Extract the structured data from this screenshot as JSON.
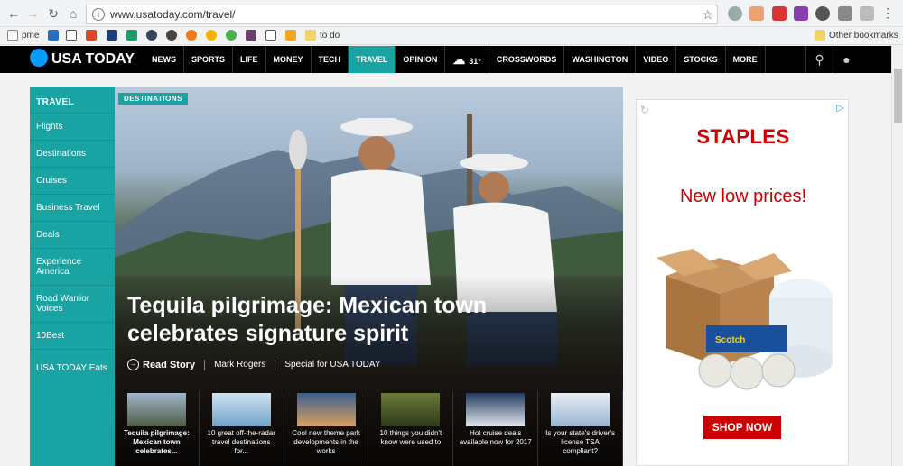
{
  "browser": {
    "url": "www.usatoday.com/travel/",
    "back_icon": "arrow-left-icon",
    "forward_icon": "arrow-right-icon",
    "reload_icon": "reload-icon",
    "home_icon": "home-icon"
  },
  "bookmarks": {
    "items": [
      {
        "label": "pme"
      },
      {
        "label": "to do"
      }
    ],
    "other": "Other bookmarks"
  },
  "site": {
    "logo": "USA TODAY",
    "nav": [
      "NEWS",
      "SPORTS",
      "LIFE",
      "MONEY",
      "TECH",
      "TRAVEL",
      "OPINION",
      "31°",
      "CROSSWORDS",
      "WASHINGTON",
      "VIDEO",
      "STOCKS",
      "MORE"
    ],
    "active_nav": "TRAVEL"
  },
  "sidebar": {
    "heading": "TRAVEL",
    "items": [
      {
        "label": "Flights"
      },
      {
        "label": "Destinations"
      },
      {
        "label": "Cruises"
      },
      {
        "label": "Business Travel"
      },
      {
        "label": "Deals"
      },
      {
        "label": "Experience America"
      },
      {
        "label": "Road Warrior Voices"
      },
      {
        "label": "10Best"
      },
      {
        "label": "USA TODAY Eats"
      }
    ]
  },
  "hero": {
    "badge": "DESTINATIONS",
    "headline": "Tequila pilgrimage: Mexican town celebrates signature spirit",
    "read_story": "Read Story",
    "author": "Mark Rogers",
    "credit": "Special for USA TODAY"
  },
  "thumbs": [
    {
      "caption": "Tequila pilgrimage: Mexican town celebrates...",
      "bold": true
    },
    {
      "caption": "10 great off-the-radar travel destinations for...",
      "bold": false
    },
    {
      "caption": "Cool new theme park developments in the works",
      "bold": false
    },
    {
      "caption": "10 things you didn't know were used to",
      "bold": false
    },
    {
      "caption": "Hot cruise deals available now for 2017",
      "bold": false
    },
    {
      "caption": "Is your state's driver's license TSA compliant?",
      "bold": false
    }
  ],
  "ad": {
    "brand": "STAPLES",
    "tagline": "New low prices!",
    "cta": "SHOP NOW"
  },
  "colors": {
    "accent": "#1aa3a3",
    "nav_bg": "#000000",
    "staples_red": "#cc0000"
  }
}
